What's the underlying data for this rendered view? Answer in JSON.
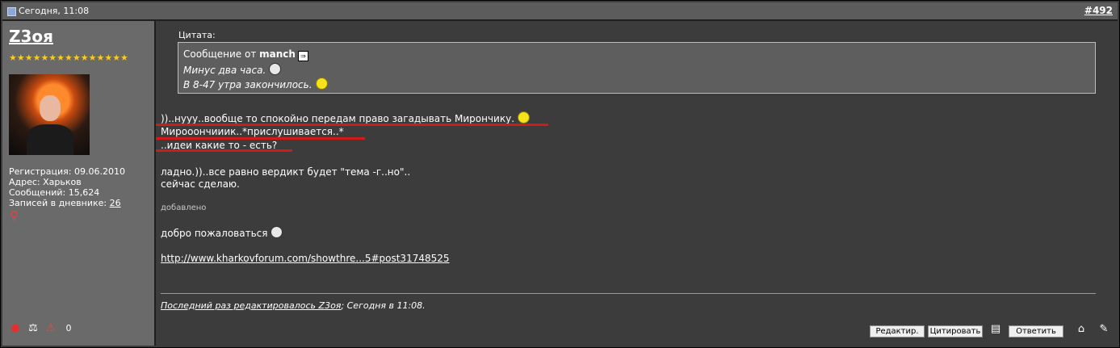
{
  "header": {
    "date": "Сегодня, 11:08",
    "post_number": "#492"
  },
  "user": {
    "name": "Z3oя",
    "stars": "★★★★★★★★★★★★★★★",
    "registration": "Регистрация: 09.06.2010",
    "address": "Адрес: Харьков",
    "messages": "Сообщений: 15,624",
    "diary_label": "Записей в дневнике: ",
    "diary_count": "26"
  },
  "quote": {
    "label": "Цитата:",
    "from_prefix": "Сообщение от ",
    "author": "manch",
    "line1": "Минус два часа.",
    "line2": "В 8-47 утра закончилось."
  },
  "post": {
    "line1": "))..нууу..вообще то спокойно передам право загадывать Мирончику.",
    "line2": "Мирооончииик..*прислушивается..*",
    "line3": "..идеи какие то - есть?",
    "line4": "ладно.))..все равно вердикт будет \"тема -г..но\"..",
    "line5": "сейчас сделаю.",
    "added_label": "добавлено",
    "welcome": "добро пожаловаться",
    "link": "http://www.kharkovforum.com/showthre...5#post31748525"
  },
  "edited": {
    "prefix": "Последний раз редактировалось Z3oя",
    "suffix": "; Сегодня в 11:08."
  },
  "buttons": {
    "edit": "Редактир.",
    "quote": "Цитировать",
    "reply": "Ответить"
  },
  "colors": {
    "underline_red": "#d11b1b",
    "stars": "#f2cc31"
  }
}
